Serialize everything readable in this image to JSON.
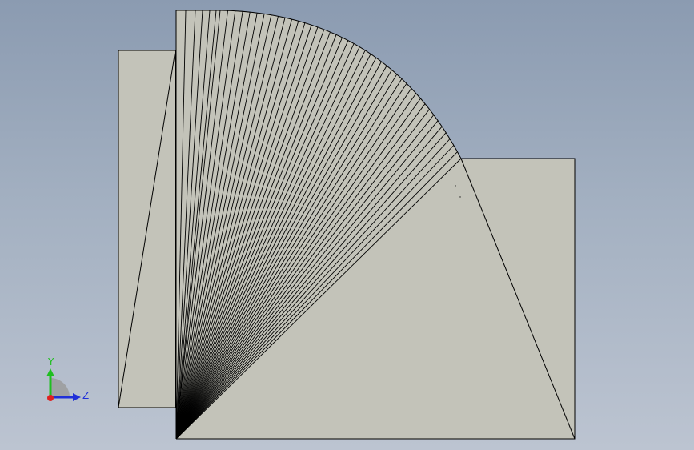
{
  "viewport": {
    "background_top": "#8b9bb1",
    "background_bottom": "#bcc4d1",
    "face_color": "#c3c3b9",
    "edge_color": "#000000",
    "fan_line_count": 48
  },
  "triad": {
    "y_label": "Y",
    "z_label": "Z",
    "y_color": "#1fbf1f",
    "z_color": "#1f2fd8",
    "x_color": "#e02020"
  }
}
